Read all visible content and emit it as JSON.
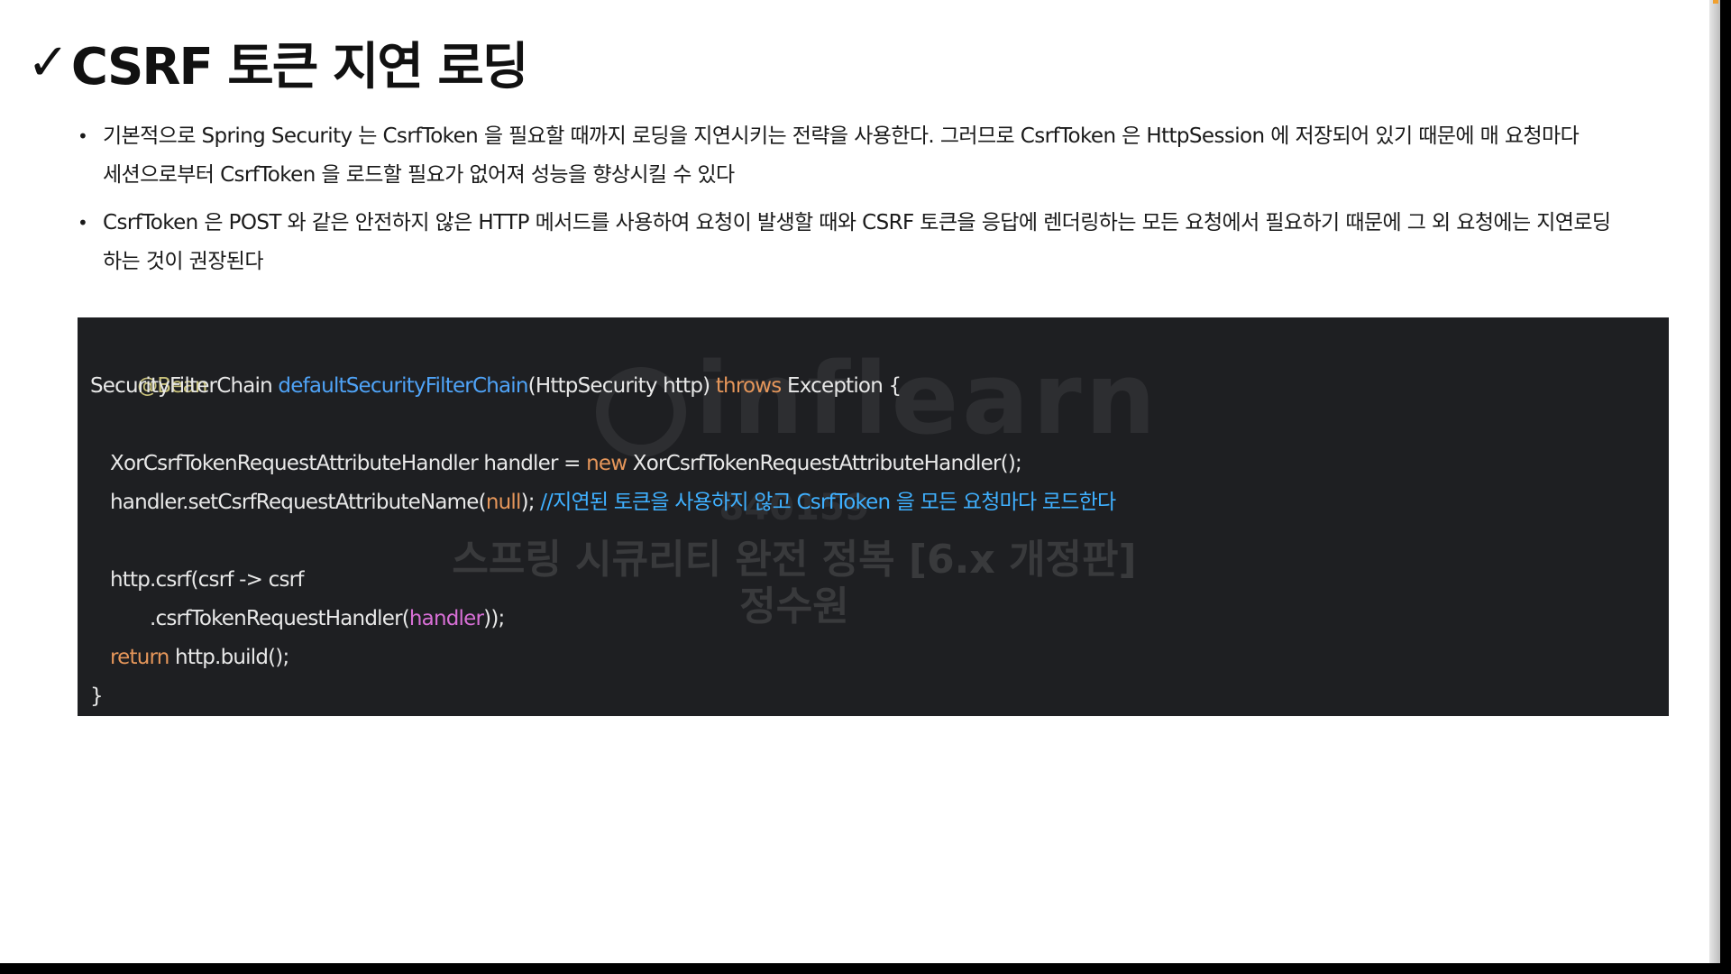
{
  "slide": {
    "title_check": "✓",
    "title": "CSRF 토큰 지연 로딩",
    "bullets": [
      {
        "line1": "기본적으로 Spring Security 는 CsrfToken 을 필요할 때까지 로딩을 지연시키는 전략을 사용한다. 그러므로 CsrfToken 은 HttpSession 에 저장되어 있기 때문에 매 요청마다",
        "line2": "세션으로부터 CsrfToken 을 로드할 필요가 없어져 성능을 향상시킬 수 있다"
      },
      {
        "line1": "CsrfToken 은 POST 와 같은 안전하지 않은 HTTP 메서드를 사용하여 요청이 발생할 때와 CSRF 토큰을 응답에 렌더링하는 모든 요청에서 필요하기 때문에 그 외 요청에는 지연로딩",
        "line2": "하는 것이 권장된다"
      }
    ],
    "bullet_marker": "•"
  },
  "code": {
    "annotation": "@Bean",
    "sig_type": "SecurityFilterChain ",
    "sig_method": "defaultSecurityFilterChain",
    "sig_params": "(HttpSecurity http) ",
    "sig_throws": "throws",
    "sig_rest": " Exception {",
    "handler_decl_a": "XorCsrfTokenRequestAttributeHandler handler = ",
    "handler_decl_new": "new",
    "handler_decl_b": " XorCsrfTokenRequestAttributeHandler();",
    "set_name_a": "handler.setCsrfRequestAttributeName(",
    "set_name_null": "null",
    "set_name_b": "); ",
    "set_name_comment": "//지연된 토큰을 사용하지 않고 CsrfToken 을 모든 요청마다 로드한다",
    "csrf_line": "http.csrf(csrf -> csrf",
    "handler_line_a": ".csrfTokenRequestHandler(",
    "handler_line_param": "handler",
    "handler_line_b": "));",
    "return_kw": "return",
    "return_rest": " http.build();",
    "close": "}"
  },
  "watermark": {
    "logo": "inflearn",
    "number": "840159",
    "course": "스프링 시큐리티 완전 정복 [6.x 개정판]",
    "author": "정수원"
  },
  "colors": {
    "code_background": "#1e1f22",
    "annotation": "#c8c17a",
    "method": "#4fa3f7",
    "keyword": "#e5965a",
    "parameter": "#d86fd6",
    "comment": "#3fb0ff"
  }
}
